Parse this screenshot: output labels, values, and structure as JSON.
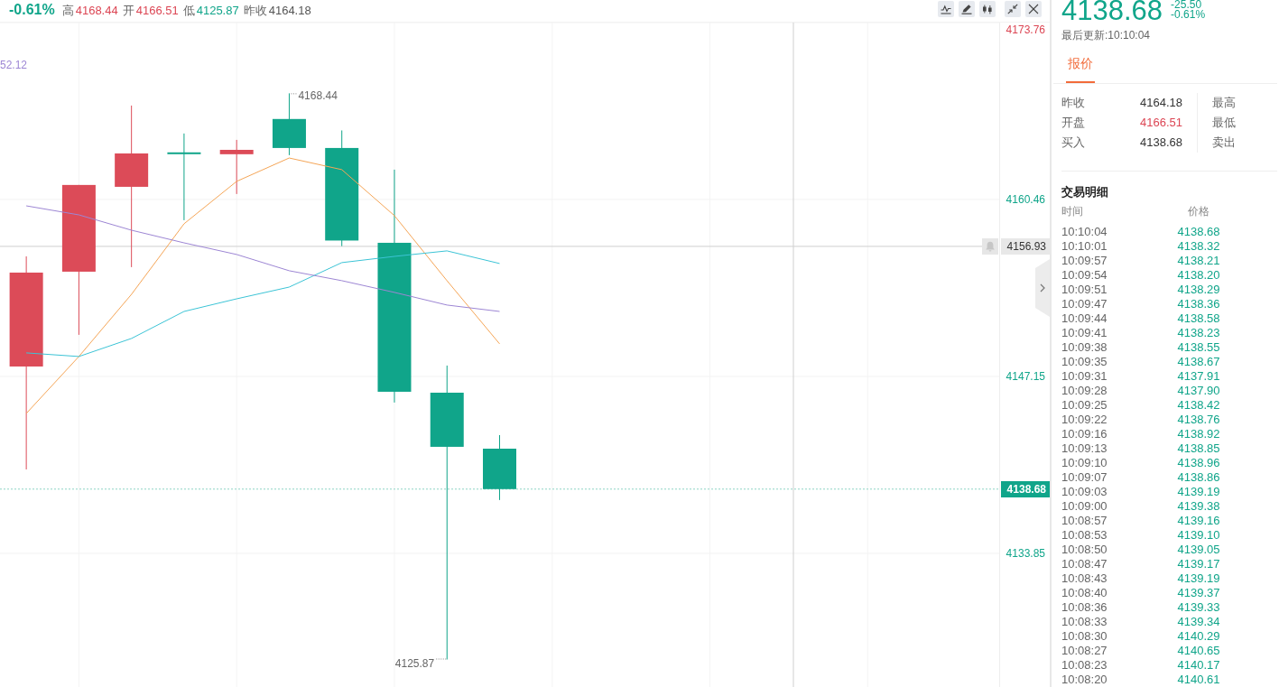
{
  "header": {
    "change_percent": "-0.61%",
    "stats": [
      {
        "label": "高",
        "value": "4168.44",
        "color": "#dc4654"
      },
      {
        "label": "开",
        "value": "4166.51",
        "color": "#dc4654"
      },
      {
        "label": "低",
        "value": "4125.87",
        "color": "#10a58a"
      },
      {
        "label": "昨收",
        "value": "4164.18",
        "color": "#555555"
      }
    ]
  },
  "chart": {
    "chart_data": {
      "type": "line",
      "categories": [
        null,
        null,
        null,
        null,
        null,
        null,
        null,
        null,
        null,
        null,
        null,
        null,
        null,
        null,
        null,
        null,
        null,
        null,
        null
      ],
      "ylim": [
        4123.8,
        4173.76
      ],
      "yticks": [
        {
          "value": 4173.76,
          "label": "4173.76"
        },
        {
          "value": 4160.46,
          "label": "4160.46"
        },
        {
          "value": 4147.15,
          "label": "4147.15"
        },
        {
          "value": 4133.85,
          "label": "4133.85"
        }
      ],
      "grid": true,
      "series": [
        {
          "color": "#f5a556",
          "values": [
            4144.37,
            4148.65,
            4153.33,
            4158.63,
            4161.82,
            4163.58,
            4162.7,
            4159.24,
            4154.35,
            4149.6,
            null,
            null,
            null,
            null,
            null,
            null,
            null,
            null,
            null
          ]
        },
        {
          "color": "#3cc4d6",
          "values": [
            4148.92,
            4148.65,
            4150.01,
            4152.04,
            4152.99,
            4153.87,
            4155.71,
            4156.18,
            4156.59,
            4155.64,
            null,
            null,
            null,
            null,
            null,
            null,
            null,
            null,
            null
          ]
        },
        {
          "color": "#9d86d4",
          "values": [
            4159.98,
            4159.3,
            4158.15,
            4157.2,
            4156.32,
            4155.1,
            4154.35,
            4153.47,
            4152.52,
            4152.04,
            null,
            null,
            null,
            null,
            null,
            null,
            null,
            null,
            null
          ]
        }
      ],
      "ref_lines": [
        {
          "axis": "y",
          "value": 4156.93,
          "label": "4156.93"
        },
        {
          "axis": "y",
          "value": 4138.68,
          "label": "4138.68"
        }
      ],
      "annotations": [
        "52.12",
        "4168.44",
        "4125.87"
      ]
    }
  },
  "quote_panel": {
    "price": "4138.68",
    "change": "-25.50",
    "change_percent": "-0.61%",
    "updated": "最后更新:10:10:04",
    "tabs": [
      {
        "label": "报价",
        "selected": true
      }
    ],
    "stats": [
      {
        "label": "昨收",
        "value": "4164.18",
        "color": "#333333"
      },
      {
        "label": "开盘",
        "value": "4166.51",
        "color": "#dc4654"
      },
      {
        "label": "买入",
        "value": "4138.68",
        "color": "#333333"
      }
    ],
    "stats_right": [
      "最高",
      "最低",
      "卖出"
    ],
    "trades": {
      "title": "交易明细",
      "columns": [
        "时间",
        "价格"
      ],
      "rows": [
        {
          "time": "10:10:04",
          "price": "4138.68"
        },
        {
          "time": "10:10:01",
          "price": "4138.32"
        },
        {
          "time": "10:09:57",
          "price": "4138.21"
        },
        {
          "time": "10:09:54",
          "price": "4138.20"
        },
        {
          "time": "10:09:51",
          "price": "4138.29"
        },
        {
          "time": "10:09:47",
          "price": "4138.36"
        },
        {
          "time": "10:09:44",
          "price": "4138.58"
        },
        {
          "time": "10:09:41",
          "price": "4138.23"
        },
        {
          "time": "10:09:38",
          "price": "4138.55"
        },
        {
          "time": "10:09:35",
          "price": "4138.67"
        },
        {
          "time": "10:09:31",
          "price": "4137.91"
        },
        {
          "time": "10:09:28",
          "price": "4137.90"
        },
        {
          "time": "10:09:25",
          "price": "4138.42"
        },
        {
          "time": "10:09:22",
          "price": "4138.76"
        },
        {
          "time": "10:09:16",
          "price": "4138.92"
        },
        {
          "time": "10:09:13",
          "price": "4138.85"
        },
        {
          "time": "10:09:10",
          "price": "4138.96"
        },
        {
          "time": "10:09:07",
          "price": "4138.86"
        },
        {
          "time": "10:09:03",
          "price": "4139.19"
        },
        {
          "time": "10:09:00",
          "price": "4139.38"
        },
        {
          "time": "10:08:57",
          "price": "4139.16"
        },
        {
          "time": "10:08:53",
          "price": "4139.10"
        },
        {
          "time": "10:08:50",
          "price": "4139.05"
        },
        {
          "time": "10:08:47",
          "price": "4139.17"
        },
        {
          "time": "10:08:43",
          "price": "4139.19"
        },
        {
          "time": "10:08:40",
          "price": "4139.37"
        },
        {
          "time": "10:08:36",
          "price": "4139.33"
        },
        {
          "time": "10:08:33",
          "price": "4139.34"
        },
        {
          "time": "10:08:30",
          "price": "4140.29"
        },
        {
          "time": "10:08:27",
          "price": "4140.65"
        },
        {
          "time": "10:08:23",
          "price": "4140.17"
        },
        {
          "time": "10:08:20",
          "price": "4140.61"
        }
      ]
    }
  }
}
